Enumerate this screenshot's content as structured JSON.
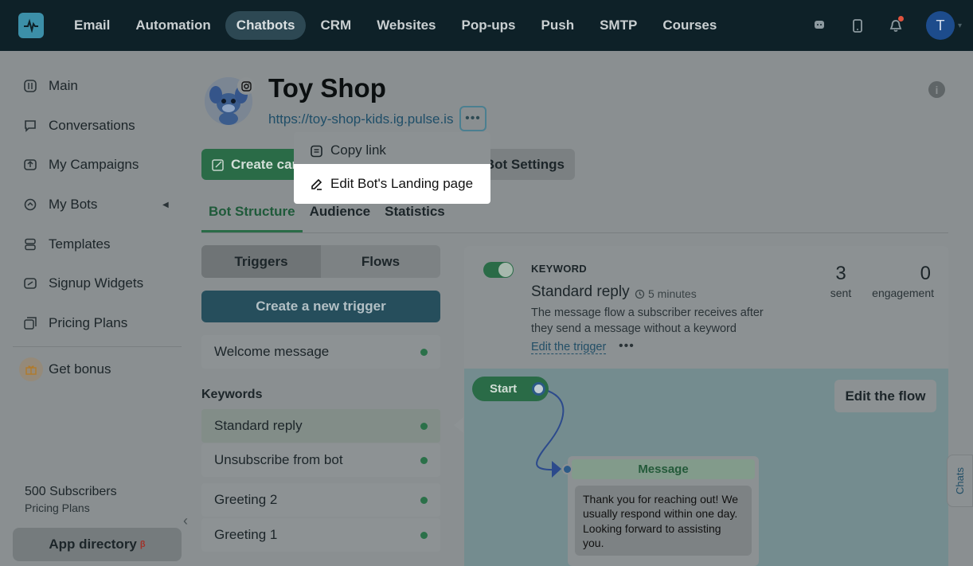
{
  "nav": {
    "items": [
      "Email",
      "Automation",
      "Chatbots",
      "CRM",
      "Websites",
      "Pop-ups",
      "Push",
      "SMTP",
      "Courses"
    ],
    "active": "Chatbots",
    "avatar_initial": "T"
  },
  "sidebar": {
    "items": [
      {
        "label": "Main",
        "icon": "gauge-icon"
      },
      {
        "label": "Conversations",
        "icon": "chat-icon"
      },
      {
        "label": "My Campaigns",
        "icon": "campaign-icon"
      },
      {
        "label": "My Bots",
        "icon": "bot-icon"
      },
      {
        "label": "Templates",
        "icon": "templates-icon"
      },
      {
        "label": "Signup Widgets",
        "icon": "widget-icon"
      },
      {
        "label": "Pricing Plans",
        "icon": "pricing-icon"
      }
    ],
    "bonus": "Get bonus",
    "subscribers": "500 Subscribers",
    "plans_link": "Pricing Plans",
    "app_directory": "App directory",
    "app_directory_badge": "β"
  },
  "bot": {
    "name": "Toy Shop",
    "url": "https://toy-shop-kids.ig.pulse.is",
    "create_button": "Create campaign",
    "settings_button": "Bot Settings"
  },
  "menu": {
    "copy_link": "Copy link",
    "edit_landing": "Edit Bot's Landing page"
  },
  "tabs": [
    "Bot Structure",
    "Audience",
    "Statistics"
  ],
  "triggers": {
    "segment": [
      "Triggers",
      "Flows"
    ],
    "create_button": "Create a new trigger",
    "welcome": "Welcome message",
    "keywords_title": "Keywords",
    "keywords": [
      "Standard reply",
      "Unsubscribe from bot"
    ],
    "others": [
      "Greeting 2",
      "Greeting 1"
    ]
  },
  "detail": {
    "type_label": "KEYWORD",
    "title": "Standard reply",
    "time": "5 minutes",
    "description": "The message flow a subscriber receives after they send a message without a keyword",
    "edit_trigger": "Edit the trigger",
    "sent_value": "3",
    "sent_label": "sent",
    "engagement_value": "0",
    "engagement_label": "engagement"
  },
  "flow": {
    "start": "Start",
    "edit_button": "Edit the flow",
    "message_title": "Message",
    "message_text": "Thank you for reaching out! We usually respond within one day. Looking forward to assisting you."
  },
  "chats_tab": "Chats",
  "colors": {
    "topbar": "#0e2128",
    "accent_green": "#2a6b47",
    "link_blue": "#1f4e68",
    "overlay": "#8a8f91"
  }
}
